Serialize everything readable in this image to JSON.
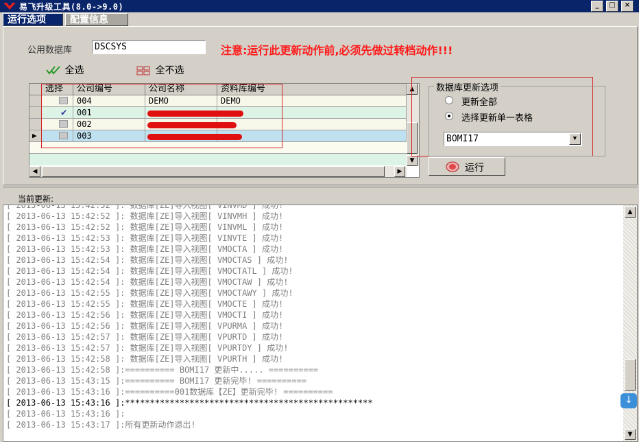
{
  "window": {
    "title": "易飞升级工具(8.0->9.0)",
    "controls": [
      "_",
      "□",
      "×"
    ]
  },
  "tabs": [
    {
      "label": "运行选项",
      "active": true
    },
    {
      "label": "配置信息",
      "active": false
    }
  ],
  "db_field": {
    "label": "公用数据库",
    "value": "DSCSYS"
  },
  "warning": "注意:运行此更新动作前,必须先做过转档动作!!!",
  "actions": {
    "select_all": "全选",
    "select_none": "全不选"
  },
  "grid": {
    "columns": [
      "选择",
      "公司编号",
      "公司名称",
      "资料库编号"
    ],
    "rows": [
      {
        "checked": false,
        "code": "004",
        "name": "DEMO",
        "db": "DEMO",
        "current": false
      },
      {
        "checked": true,
        "code": "001",
        "name": "",
        "db": "",
        "current": false
      },
      {
        "checked": false,
        "code": "002",
        "name": "",
        "db": "",
        "current": false
      },
      {
        "checked": false,
        "code": "003",
        "name": "",
        "db": "",
        "current": true
      }
    ]
  },
  "update_options": {
    "title": "数据库更新选项",
    "option_all": "更新全部",
    "option_single": "选择更新单一表格",
    "selected": "single",
    "table_value": "BOMI17"
  },
  "run_button": "运行",
  "status_label": "当前更新:",
  "log_lines": [
    "[ 2013-06-13 15:42:52 ]: 数据库[ZE]导入视图[ VINVMH ] 成功!",
    "[ 2013-06-13 15:42:52 ]: 数据库[ZE]导入视图[ VINVML ] 成功!",
    "[ 2013-06-13 15:42:53 ]: 数据库[ZE]导入视图[ VINVTE ] 成功!",
    "[ 2013-06-13 15:42:53 ]: 数据库[ZE]导入视图[ VMOCTA ] 成功!",
    "[ 2013-06-13 15:42:54 ]: 数据库[ZE]导入视图[ VMOCTAS ] 成功!",
    "[ 2013-06-13 15:42:54 ]: 数据库[ZE]导入视图[ VMOCTATL ] 成功!",
    "[ 2013-06-13 15:42:54 ]: 数据库[ZE]导入视图[ VMOCTAW ] 成功!",
    "[ 2013-06-13 15:42:55 ]: 数据库[ZE]导入视图[ VMOCTAWY ] 成功!",
    "[ 2013-06-13 15:42:55 ]: 数据库[ZE]导入视图[ VMOCTE ] 成功!",
    "[ 2013-06-13 15:42:56 ]: 数据库[ZE]导入视图[ VMOCTI ] 成功!",
    "[ 2013-06-13 15:42:56 ]: 数据库[ZE]导入视图[ VPURMA ] 成功!",
    "[ 2013-06-13 15:42:57 ]: 数据库[ZE]导入视图[ VPURTD ] 成功!",
    "[ 2013-06-13 15:42:57 ]: 数据库[ZE]导入视图[ VPURTDY ] 成功!",
    "[ 2013-06-13 15:42:58 ]: 数据库[ZE]导入视图[ VPURTH ] 成功!",
    "[ 2013-06-13 15:42:58 ]:========== BOMI17 更新中..... ==========",
    "[ 2013-06-13 15:43:15 ]:========== BOMI17 更新完毕! ==========",
    "[ 2013-06-13 15:43:16 ]:==========001数据库【ZE】更新完毕! ==========",
    "[ 2013-06-13 15:43:16 ]:**************************************************",
    "[ 2013-06-13 15:43:16 ]:",
    "[ 2013-06-13 15:43:17 ]:所有更新动作退出!"
  ]
}
